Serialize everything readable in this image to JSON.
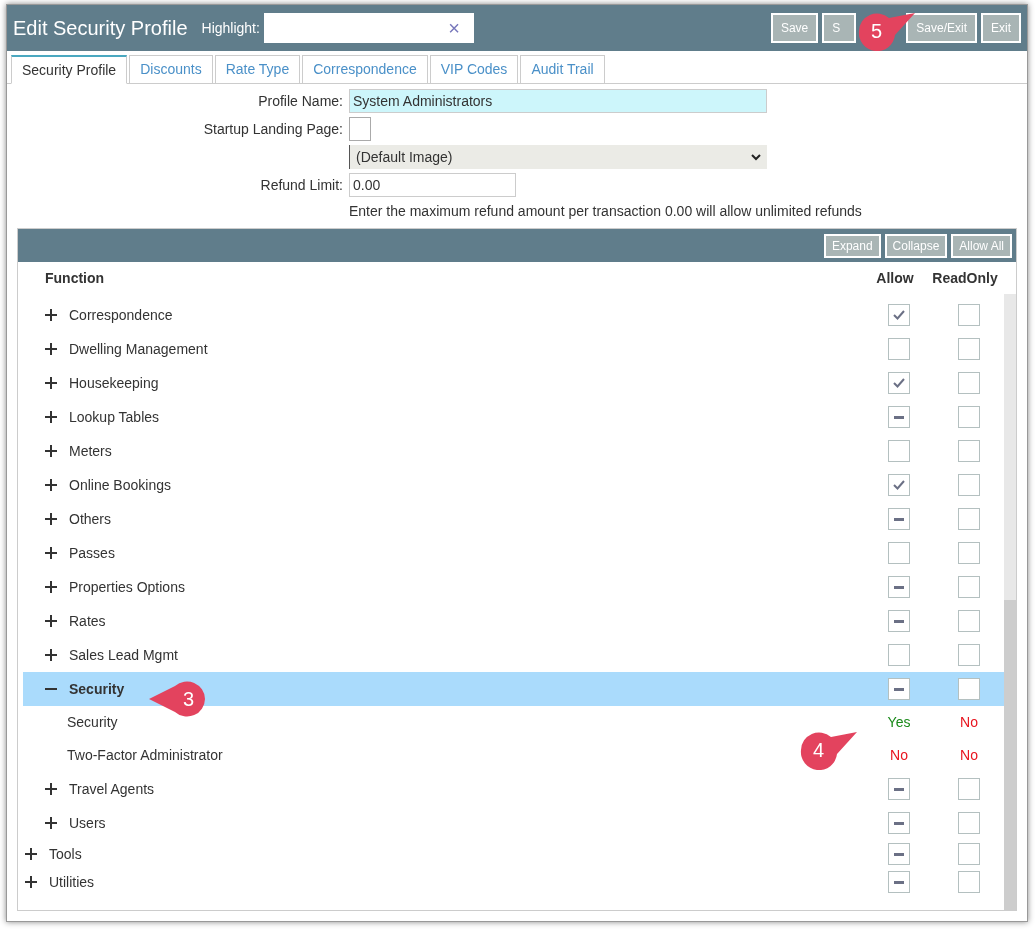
{
  "window": {
    "title": "Edit Security Profile"
  },
  "highlight": {
    "label": "Highlight:",
    "clear": "×"
  },
  "toolbar_buttons": [
    "Save",
    "S",
    "Save/Exit",
    "Exit"
  ],
  "tabs": [
    {
      "label": "Security Profile",
      "selected": true
    },
    {
      "label": "Discounts",
      "selected": false
    },
    {
      "label": "Rate Type",
      "selected": false
    },
    {
      "label": "Correspondence",
      "selected": false
    },
    {
      "label": "VIP Codes",
      "selected": false
    },
    {
      "label": "Audit Trail",
      "selected": false
    }
  ],
  "form": {
    "profile_name": {
      "label": "Profile Name:",
      "value": "System Administrators"
    },
    "startup_landing_page": {
      "label": "Startup Landing Page:",
      "checked": false
    },
    "image_select": {
      "value": "(Default Image)"
    },
    "refund_limit": {
      "label": "Refund Limit:",
      "value": "0.00"
    },
    "hint": "Enter the maximum refund amount per transaction 0.00 will allow unlimited refunds"
  },
  "grid": {
    "buttons": [
      "Expand",
      "Collapse",
      "Allow All"
    ],
    "columns": [
      "Function",
      "Allow",
      "ReadOnly"
    ],
    "rows": [
      {
        "kind": "group",
        "children": [
          {
            "kind": "group",
            "label": "Correspondence",
            "expanded": false,
            "selected": false,
            "allow_checked": true,
            "allow_partial": false,
            "readonly_checked": false
          },
          {
            "kind": "group",
            "label": "Dwelling Management",
            "expanded": false,
            "selected": false,
            "allow_checked": false,
            "allow_partial": false,
            "readonly_checked": false
          },
          {
            "kind": "group",
            "label": "Housekeeping",
            "expanded": false,
            "selected": false,
            "allow_checked": true,
            "allow_partial": false,
            "readonly_checked": false
          },
          {
            "kind": "group",
            "label": "Lookup Tables",
            "expanded": false,
            "selected": false,
            "allow_checked": false,
            "allow_partial": true,
            "readonly_checked": false
          },
          {
            "kind": "group",
            "label": "Meters",
            "expanded": false,
            "selected": false,
            "allow_checked": false,
            "allow_partial": false,
            "readonly_checked": false
          },
          {
            "kind": "group",
            "label": "Online Bookings",
            "expanded": false,
            "selected": false,
            "allow_checked": true,
            "allow_partial": false,
            "readonly_checked": false
          },
          {
            "kind": "group",
            "label": "Others",
            "expanded": false,
            "selected": false,
            "allow_checked": false,
            "allow_partial": true,
            "readonly_checked": false
          },
          {
            "kind": "group",
            "label": "Passes",
            "expanded": false,
            "selected": false,
            "allow_checked": false,
            "allow_partial": false,
            "readonly_checked": false
          },
          {
            "kind": "group",
            "label": "Properties Options",
            "expanded": false,
            "selected": false,
            "allow_checked": false,
            "allow_partial": true,
            "readonly_checked": false
          },
          {
            "kind": "group",
            "label": "Rates",
            "expanded": false,
            "selected": false,
            "allow_checked": false,
            "allow_partial": true,
            "readonly_checked": false
          },
          {
            "kind": "group",
            "label": "Sales Lead Mgmt",
            "expanded": false,
            "selected": false,
            "allow_checked": false,
            "allow_partial": false,
            "readonly_checked": false
          },
          {
            "kind": "group",
            "label": "Security",
            "expanded": true,
            "selected": true,
            "allow_checked": false,
            "allow_partial": true,
            "readonly_checked": false,
            "children": [
              {
                "kind": "permission",
                "label": "Security",
                "allow_text": "Yes",
                "allow_granted": true,
                "readonly_text": "No",
                "readonly_granted": false
              },
              {
                "kind": "permission",
                "label": "Two-Factor Administrator",
                "allow_text": "No",
                "allow_granted": false,
                "readonly_text": "No",
                "readonly_granted": false
              }
            ]
          },
          {
            "kind": "group",
            "label": "Travel Agents",
            "expanded": false,
            "selected": false,
            "allow_checked": false,
            "allow_partial": true,
            "readonly_checked": false
          },
          {
            "kind": "group",
            "label": "Users",
            "expanded": false,
            "selected": false,
            "allow_checked": false,
            "allow_partial": true,
            "readonly_checked": false
          }
        ]
      },
      {
        "kind": "group",
        "label": "Tools",
        "expanded": false,
        "selected": false,
        "allow_checked": false,
        "allow_partial": true,
        "readonly_checked": false
      },
      {
        "kind": "group",
        "label": "Utilities",
        "expanded": false,
        "selected": false,
        "allow_checked": false,
        "allow_partial": true,
        "readonly_checked": false
      }
    ]
  },
  "callouts": [
    {
      "label": "5",
      "kind": "right"
    },
    {
      "label": "3",
      "kind": "left"
    },
    {
      "label": "4",
      "kind": "right"
    }
  ]
}
